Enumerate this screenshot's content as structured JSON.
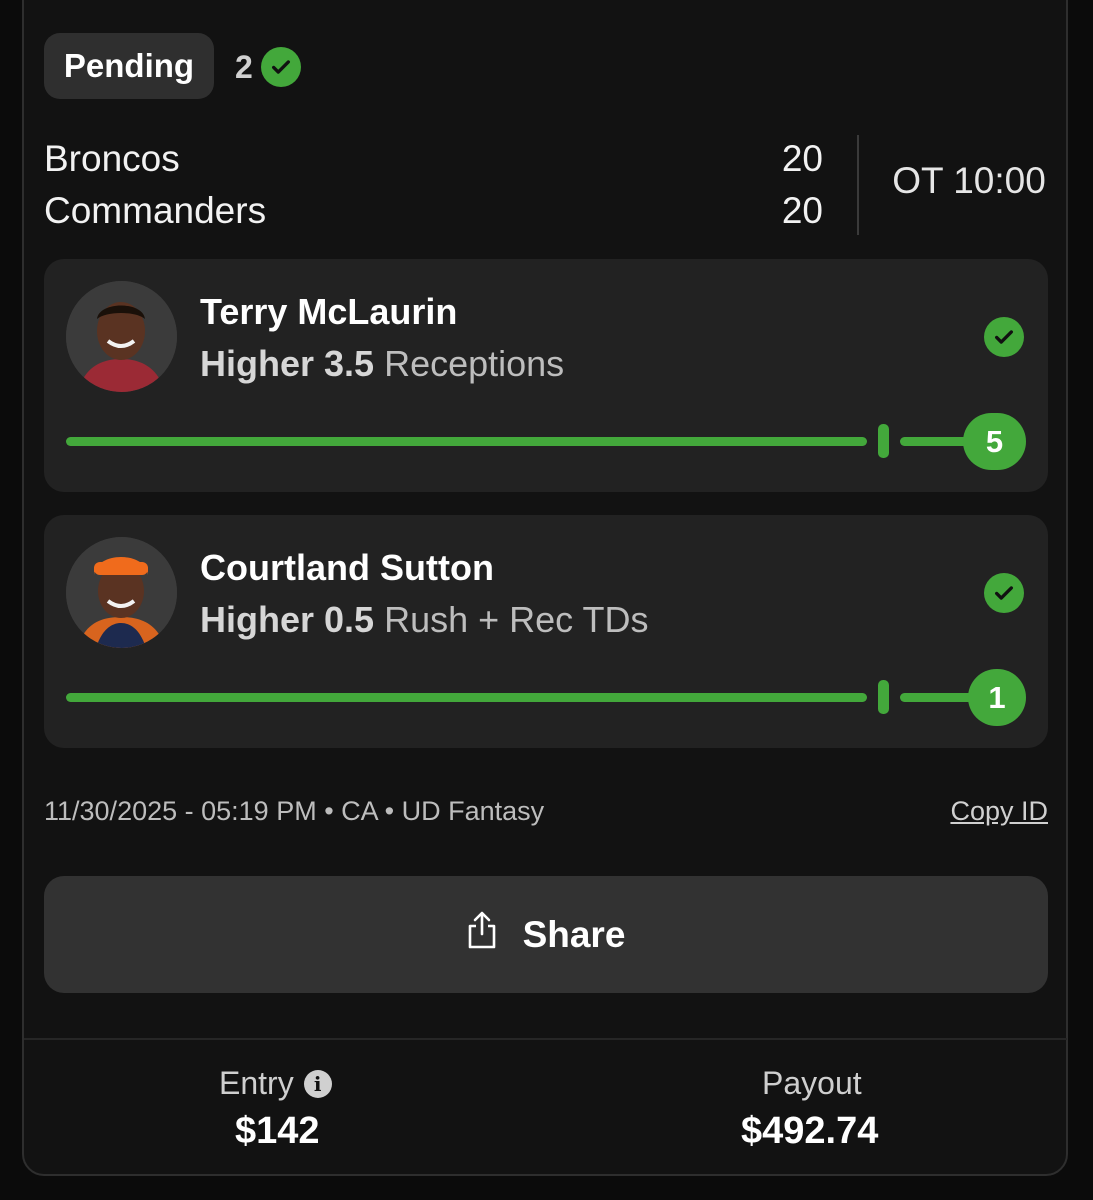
{
  "status": {
    "badge": "Pending",
    "hits": "2"
  },
  "game": {
    "teams": [
      {
        "name": "Broncos",
        "score": "20"
      },
      {
        "name": "Commanders",
        "score": "20"
      }
    ],
    "clock": "OT 10:00"
  },
  "picks": [
    {
      "player": "Terry McLaurin",
      "direction": "Higher 3.5",
      "stat": "Receptions",
      "result": "5",
      "line": 3.5,
      "progress_fraction": 1.0
    },
    {
      "player": "Courtland Sutton",
      "direction": "Higher 0.5",
      "stat": "Rush + Rec TDs",
      "result": "1",
      "line": 0.5,
      "progress_fraction": 1.0
    }
  ],
  "meta": {
    "timestamp": "11/30/2025 - 05:19 PM • CA • UD Fantasy",
    "copy_id": "Copy ID"
  },
  "share": {
    "label": "Share"
  },
  "footer": {
    "entry_label": "Entry",
    "entry_value": "$142",
    "payout_label": "Payout",
    "payout_value": "$492.74"
  },
  "colors": {
    "accent": "#43a83b",
    "card": "#222222",
    "background": "#121212"
  }
}
